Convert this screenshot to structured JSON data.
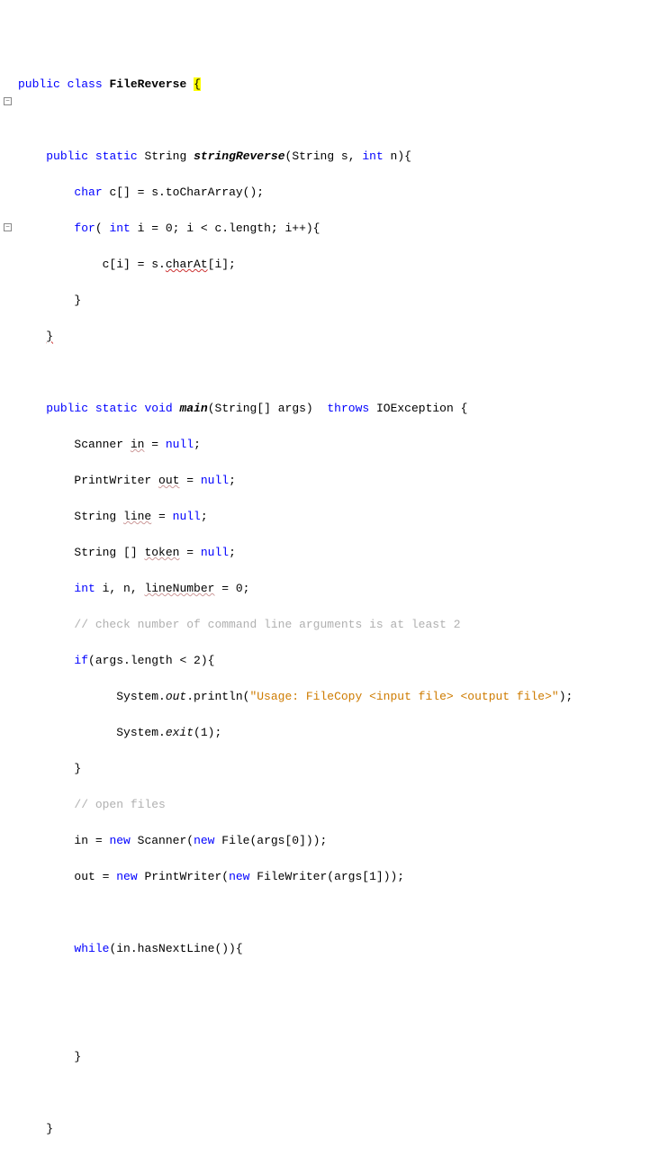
{
  "code": {
    "l1_public": "public",
    "l1_class": "class",
    "l1_name": "FileReverse",
    "l1_brace": "{",
    "l3_public": "public",
    "l3_static": "static",
    "l3_ret": "String",
    "l3_method": "stringReverse",
    "l3_params": "(String s, ",
    "l3_int": "int",
    "l3_rest": " n){",
    "l4_char": "char",
    "l4_rest": " c[] = s.toCharArray();",
    "l5_for": "for",
    "l5_open": "( ",
    "l5_int": "int",
    "l5_rest1": " i = 0; i < c.",
    "l5_length": "length",
    "l5_rest2": "; i++){",
    "l6_pre": "c[i] = s.",
    "l6_charAt": "charAt",
    "l6_rest": "[i];",
    "l7_brace": "}",
    "l8_brace": "}",
    "l10_public": "public",
    "l10_static": "static",
    "l10_void": "void",
    "l10_main": "main",
    "l10_params": "(String[] args) ",
    "l10_throws": "throws",
    "l10_rest": " IOException {",
    "l11_pre": "Scanner ",
    "l11_in": "in",
    "l11_eq": " = ",
    "l11_null": "null",
    "l11_semi": ";",
    "l12_pre": "PrintWriter ",
    "l12_out": "out",
    "l12_eq": " = ",
    "l12_null": "null",
    "l12_semi": ";",
    "l13_pre": "String ",
    "l13_line": "line",
    "l13_eq": " = ",
    "l13_null": "null",
    "l13_semi": ";",
    "l14_pre": "String [] ",
    "l14_token": "token",
    "l14_eq": " = ",
    "l14_null": "null",
    "l14_semi": ";",
    "l15_int": "int",
    "l15_pre": " i, n, ",
    "l15_lineNumber": "lineNumber",
    "l15_rest": " = 0;",
    "l16_comment": "// check number of command line arguments is at least 2",
    "l17_if": "if",
    "l17_pre": "(args.",
    "l17_length": "length",
    "l17_rest": " < 2){",
    "l18_pre": "System.",
    "l18_out": "out",
    "l18_mid": ".println(",
    "l18_str": "\"Usage: FileCopy <input file> <output file>\"",
    "l18_rest": ");",
    "l19_pre": "System.",
    "l19_exit": "exit",
    "l19_rest": "(1);",
    "l20_brace": "}",
    "l21_comment": "// open files",
    "l22_pre": "in = ",
    "l22_new1": "new",
    "l22_mid1": " Scanner(",
    "l22_new2": "new",
    "l22_rest": " File(args[0]));",
    "l23_pre": "out = ",
    "l23_new1": "new",
    "l23_mid1": " PrintWriter(",
    "l23_new2": "new",
    "l23_rest": " FileWriter(args[1]));",
    "l25_while": "while",
    "l25_rest": "(in.hasNextLine()){",
    "l28_brace": "}",
    "l30_brace": "}"
  }
}
